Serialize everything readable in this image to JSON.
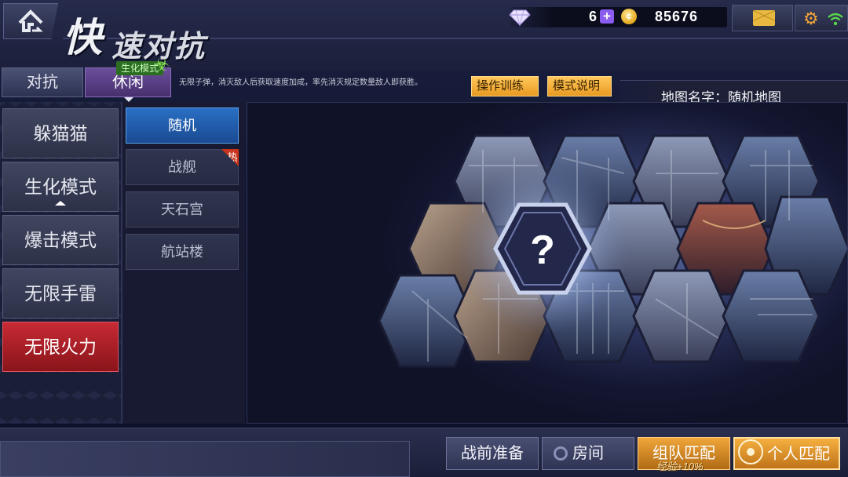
{
  "header": {
    "title_part1": "快",
    "title_part2": "速对抗",
    "diamonds": "6",
    "coins": "85676",
    "coin_symbol": "¢",
    "icons": [
      "home-icon",
      "diamond-icon",
      "plus-icon",
      "coin-icon",
      "mail-icon",
      "gear-icon",
      "wifi-icon"
    ]
  },
  "tabs": [
    {
      "label": "对抗",
      "active": false
    },
    {
      "label": "休闲",
      "active": true
    }
  ],
  "mode_badge": "生化模式",
  "description": "无限子弹，消灭敌人后获取速度加成，率先消灭规定数量敌人即获胜。",
  "buttons": {
    "training": "操作训练",
    "mode_info": "模式说明"
  },
  "map_name": "地图名字：随机地图",
  "modes": [
    {
      "label": "躲猫猫",
      "active": false
    },
    {
      "label": "生化模式",
      "active": false
    },
    {
      "label": "爆击模式",
      "active": false
    },
    {
      "label": "无限手雷",
      "active": false
    },
    {
      "label": "无限火力",
      "active": true
    }
  ],
  "maps": [
    {
      "label": "随机",
      "active": true
    },
    {
      "label": "战舰",
      "active": false,
      "badge": "热"
    },
    {
      "label": "天石宫",
      "active": false
    },
    {
      "label": "航站楼",
      "active": false
    }
  ],
  "preview": {
    "center_glyph": "?"
  },
  "bottom": {
    "prep": "战前准备",
    "room": "房间",
    "team_match": "组队匹配",
    "exp_bonus": "经验+10%",
    "solo_match": "个人匹配"
  },
  "colors": {
    "accent_gold": "#f0a63a",
    "active_red": "#c82a34",
    "active_blue": "#2a6fc4",
    "casual_purple": "#6a4e9a"
  }
}
